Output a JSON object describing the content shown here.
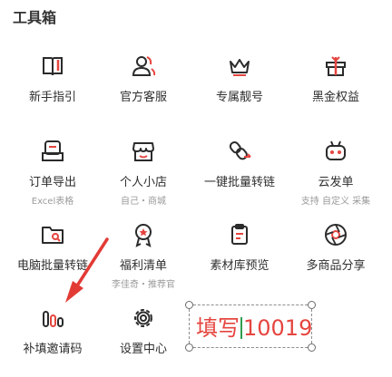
{
  "section_title": "工具箱",
  "tools": [
    {
      "label": "新手指引",
      "sub": ""
    },
    {
      "label": "官方客服",
      "sub": ""
    },
    {
      "label": "专属靓号",
      "sub": ""
    },
    {
      "label": "黑金权益",
      "sub": ""
    },
    {
      "label": "订单导出",
      "sub": "Excel表格"
    },
    {
      "label": "个人小店",
      "sub": "自己・商城"
    },
    {
      "label": "一键批量转链",
      "sub": ""
    },
    {
      "label": "云发单",
      "sub": "支持 自定义 采集"
    },
    {
      "label": "电脑批量转链",
      "sub": ""
    },
    {
      "label": "福利清单",
      "sub": "李佳奇・推荐官"
    },
    {
      "label": "素材库预览",
      "sub": ""
    },
    {
      "label": "多商品分享",
      "sub": ""
    },
    {
      "label": "补填邀请码",
      "sub": ""
    },
    {
      "label": "设置中心",
      "sub": ""
    }
  ],
  "edit_box": {
    "prefix": "填写",
    "suffix": "10019"
  },
  "colors": {
    "accent": "#e5453f",
    "icon": "#2b2b2b",
    "arrow": "#e23b35"
  }
}
